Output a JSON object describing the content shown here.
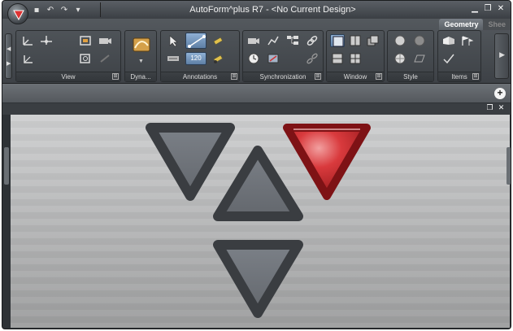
{
  "window": {
    "title": "AutoForm^plus R7 - <No Current Design>",
    "controls": {
      "minimize": "▁",
      "restore": "❐",
      "close": "✕"
    }
  },
  "quick_access": [
    "save-icon",
    "undo-icon",
    "redo-icon",
    "customize-icon"
  ],
  "ribbon": {
    "tabs": [
      {
        "label": "Geometry",
        "active": true
      },
      {
        "label": "Shee",
        "active": false
      }
    ],
    "groups": [
      {
        "label": "View"
      },
      {
        "label": "Dyna..."
      },
      {
        "label": "Annotations"
      },
      {
        "label": "Synchronization"
      },
      {
        "label": "Window"
      },
      {
        "label": "Style"
      },
      {
        "label": "Items"
      }
    ],
    "annotation_value": "120"
  },
  "toolbar": {
    "add_label": "+"
  },
  "panel": {
    "restore": "❐",
    "close": "✕"
  },
  "navigator": {
    "colors": {
      "arrow_fill": "#6f747a",
      "arrow_border": "#3a3d41",
      "active_fill": "#c8282b"
    },
    "arrows": [
      "down-left-arrow",
      "up-center-arrow",
      "down-right-arrow-active",
      "down-bottom-arrow"
    ]
  }
}
